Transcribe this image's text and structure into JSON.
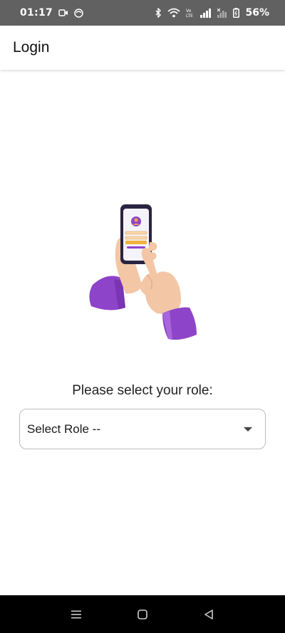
{
  "status_bar": {
    "time": "01:17",
    "battery": "56%",
    "icons": [
      "video-icon",
      "notification-icon",
      "bluetooth-icon",
      "wifi-icon",
      "volte-icon",
      "signal-icon",
      "signal-x-icon",
      "battery-icon"
    ]
  },
  "app_bar": {
    "title": "Login"
  },
  "content": {
    "prompt": "Please select your role:",
    "role_select": {
      "value": "Select Role --"
    }
  },
  "nav_bar": {
    "icons": [
      "menu-icon",
      "home-icon",
      "back-icon"
    ]
  },
  "colors": {
    "accent": "#8E44C9",
    "status_bar_bg": "#616161",
    "nav_bar_bg": "#000000"
  }
}
